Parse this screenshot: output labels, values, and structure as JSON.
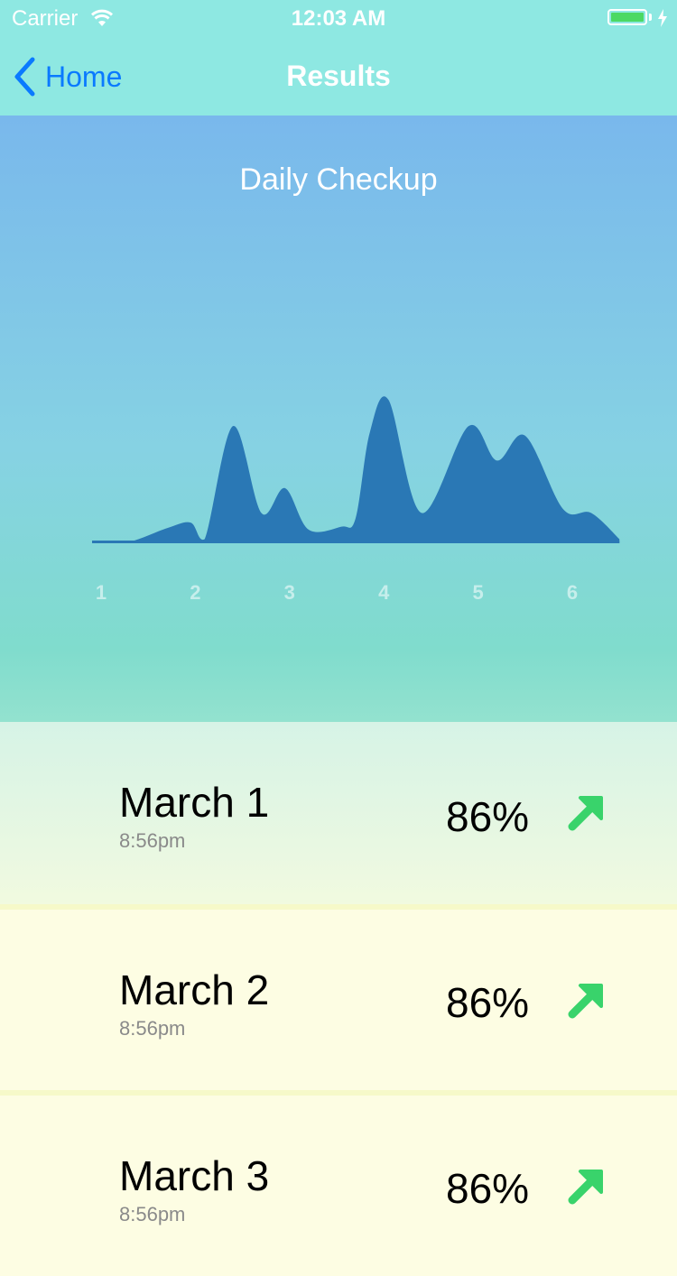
{
  "status_bar": {
    "carrier": "Carrier",
    "time": "12:03 AM"
  },
  "nav": {
    "back_label": "Home",
    "title": "Results"
  },
  "chart_data": {
    "type": "area",
    "title": "Daily Checkup",
    "x_ticks": [
      "1",
      "2",
      "3",
      "4",
      "5",
      "6"
    ],
    "x": [
      1.0,
      1.3,
      1.7,
      1.95,
      2.1,
      2.4,
      2.7,
      2.95,
      3.2,
      3.55,
      3.7,
      3.85,
      4.05,
      4.4,
      4.9,
      5.2,
      5.5,
      5.9,
      6.2,
      6.5
    ],
    "values": [
      0.5,
      1.0,
      11,
      15,
      3,
      85,
      22,
      40,
      10,
      12,
      18,
      80,
      104,
      22,
      85,
      60,
      78,
      25,
      22,
      3
    ],
    "ylim": [
      0,
      110
    ],
    "fill_color": "#2a78b5",
    "grid": false
  },
  "results": [
    {
      "date": "March 1",
      "time": "8:56pm",
      "score": "86%",
      "trend": "up-arrow-icon"
    },
    {
      "date": "March 2",
      "time": "8:56pm",
      "score": "86%",
      "trend": "up-arrow-icon"
    },
    {
      "date": "March 3",
      "time": "8:56pm",
      "score": "86%",
      "trend": "up-arrow-icon"
    }
  ],
  "colors": {
    "nav_bg": "#8ee8e2",
    "accent": "#0a7aff",
    "trend_up": "#39d36b",
    "row1_bg_top": "#d6f3e6",
    "row1_bg_bottom": "#f1fae0",
    "row_bg": "#fdfde3"
  }
}
